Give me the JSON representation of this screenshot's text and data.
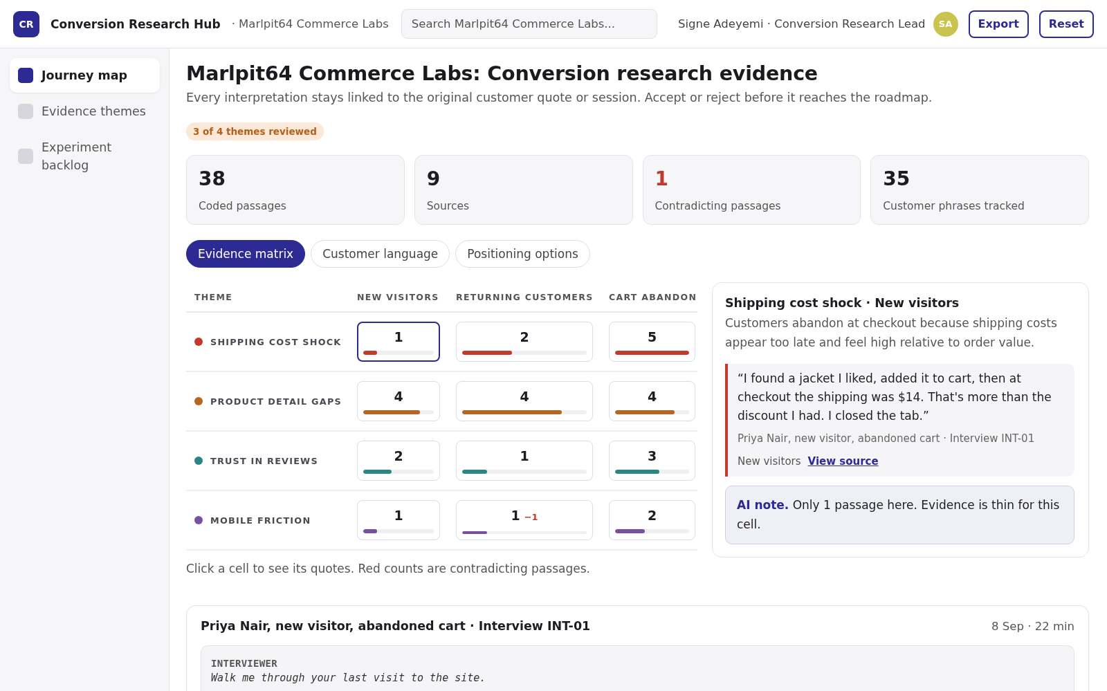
{
  "app": {
    "logo": "CR",
    "title": "Conversion Research Hub",
    "workspace": "· Marlpit64 Commerce Labs"
  },
  "search": {
    "placeholder": "Search Marlpit64 Commerce Labs..."
  },
  "user": {
    "label": "Signe Adeyemi · Conversion Research Lead",
    "initials": "SA"
  },
  "actions": [
    "Export",
    "Reset"
  ],
  "sidebar": {
    "items": [
      {
        "label": "Journey map",
        "selected": true
      },
      {
        "label": "Evidence themes",
        "selected": false
      },
      {
        "label": "Experiment backlog",
        "selected": false
      }
    ]
  },
  "page": {
    "title": "Marlpit64 Commerce Labs: Conversion research evidence",
    "subtitle": "Every interpretation stays linked to the original customer quote or session. Accept or reject before it reaches the roadmap.",
    "badge": "3 of 4 themes reviewed"
  },
  "stats": [
    {
      "value": "38",
      "label": "Coded passages",
      "alert": false
    },
    {
      "value": "9",
      "label": "Sources",
      "alert": false
    },
    {
      "value": "1",
      "label": "Contradicting passages",
      "alert": true
    },
    {
      "value": "35",
      "label": "Customer phrases tracked",
      "alert": false
    }
  ],
  "tabs": [
    {
      "label": "Evidence matrix",
      "selected": true
    },
    {
      "label": "Customer language",
      "selected": false
    },
    {
      "label": "Positioning options",
      "selected": false
    }
  ],
  "matrix": {
    "theme_header": "THEME",
    "columns": [
      "NEW VISITORS",
      "RETURNING CUSTOMERS",
      "CART ABANDON"
    ],
    "rows": [
      {
        "theme": "SHIPPING COST SHOCK",
        "color": "#c4392d",
        "cells": [
          {
            "count": "1",
            "level": 0.2,
            "selected": true
          },
          {
            "count": "2",
            "level": 0.4,
            "selected": false
          },
          {
            "count": "5",
            "level": 1,
            "selected": false
          }
        ]
      },
      {
        "theme": "PRODUCT DETAIL GAPS",
        "color": "#b8661f",
        "cells": [
          {
            "count": "4",
            "level": 0.8,
            "selected": false
          },
          {
            "count": "4",
            "level": 0.8,
            "selected": false
          },
          {
            "count": "4",
            "level": 0.8,
            "selected": false
          }
        ]
      },
      {
        "theme": "TRUST IN REVIEWS",
        "color": "#2a8683",
        "cells": [
          {
            "count": "2",
            "level": 0.4,
            "selected": false
          },
          {
            "count": "1",
            "level": 0.2,
            "selected": false
          },
          {
            "count": "3",
            "level": 0.6,
            "selected": false
          }
        ]
      },
      {
        "theme": "MOBILE FRICTION",
        "color": "#7b4f9f",
        "cells": [
          {
            "count": "1",
            "level": 0.2,
            "selected": false
          },
          {
            "count": "1",
            "contradicting": "−1",
            "level": 0.2,
            "selected": false
          },
          {
            "count": "2",
            "level": 0.4,
            "selected": false
          }
        ]
      }
    ],
    "hint": "Click a cell to see its quotes. Red counts are contradicting passages."
  },
  "detail": {
    "title": "Shipping cost shock · New visitors",
    "summary": "Customers abandon at checkout because shipping costs appear too late and feel high relative to order value.",
    "quote": {
      "text": "“I found a jacket I liked, added it to cart, then at checkout the shipping was $14. That's more than the discount I had. I closed the tab.”",
      "attribution": "Priya Nair, new visitor, abandoned cart · Interview INT-01",
      "segment": "New visitors",
      "link": "View source"
    },
    "note": "**AI note.** Only 1 passage here. Evidence is thin for this cell."
  },
  "transcript": {
    "title": "Priya Nair, new visitor, abandoned cart · Interview INT-01",
    "meta": "8 Sep · 22 min",
    "turns": [
      {
        "speaker": "INTERVIEWER",
        "text": "Walk me through your last visit to the site."
      }
    ]
  }
}
